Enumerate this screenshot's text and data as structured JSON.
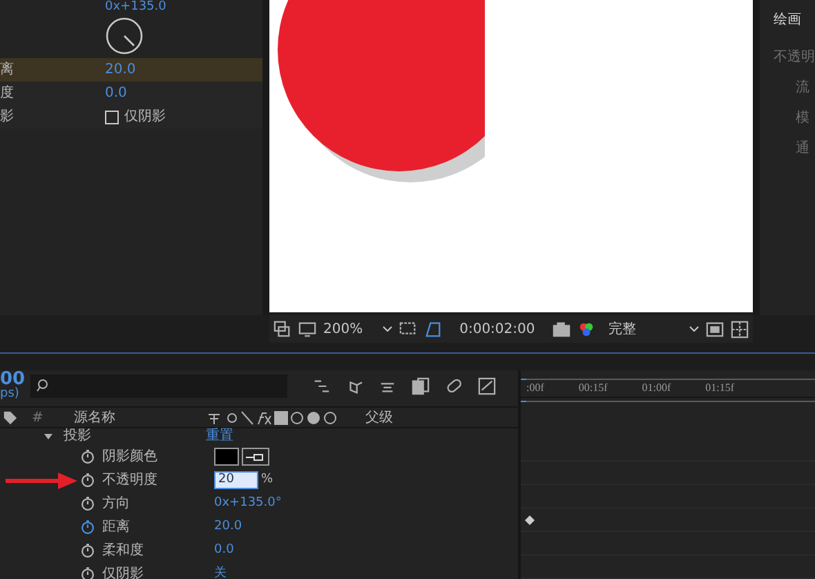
{
  "effect_controls": {
    "top_value": "0x+135.0",
    "rows": [
      {
        "label": "离",
        "value": "20.0",
        "highlighted": true,
        "kind": "value"
      },
      {
        "label": "度",
        "value": "0.0",
        "highlighted": false,
        "kind": "value"
      },
      {
        "label": "影",
        "value": "仅阴影",
        "highlighted": false,
        "kind": "checkbox",
        "checked": false
      }
    ]
  },
  "viewer": {
    "zoom": "200%",
    "timecode": "0:00:02:00",
    "resolution": "完整"
  },
  "right_panel": {
    "title": "绘画",
    "items": [
      "不透明",
      "流",
      "模",
      "通"
    ]
  },
  "timeline": {
    "current_time": "00",
    "fps": "ps)",
    "columns": [
      "#",
      "源名称",
      "父级"
    ],
    "layers": [
      {
        "name": "投影",
        "value": "重置",
        "expanded": true,
        "children": [
          {
            "name": "阴影颜色",
            "kind": "color",
            "color": "#000000",
            "keyframed": false
          },
          {
            "name": "不透明度",
            "kind": "input",
            "value": "20",
            "unit": "%",
            "keyframed": false,
            "annotated": true
          },
          {
            "name": "方向",
            "kind": "value",
            "value": "0x+135.0°",
            "keyframed": false
          },
          {
            "name": "距离",
            "kind": "value",
            "value": "20.0",
            "keyframed": true
          },
          {
            "name": "柔和度",
            "kind": "value",
            "value": "0.0",
            "keyframed": false
          },
          {
            "name": "仅阴影",
            "kind": "value",
            "value": "关",
            "keyframed": false
          }
        ]
      }
    ],
    "ruler": [
      ":00f",
      "00:15f",
      "01:00f",
      "01:15f"
    ]
  }
}
